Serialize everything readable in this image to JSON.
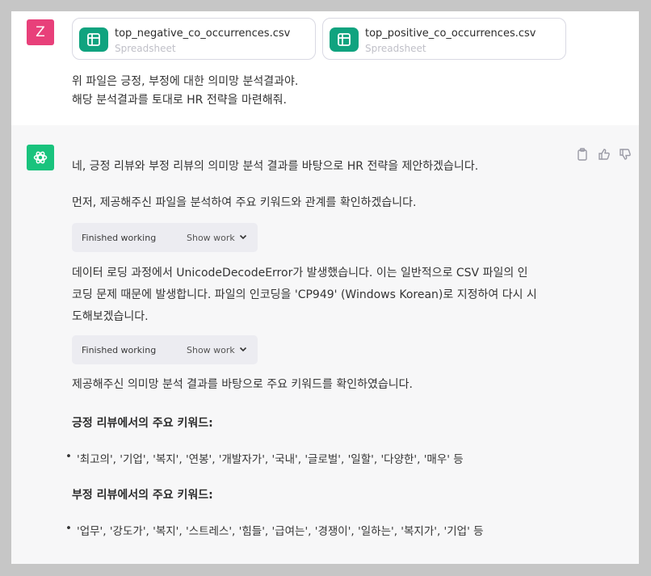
{
  "user": {
    "avatar_initial": "Z",
    "files": [
      {
        "name": "top_negative_co_occurrences.csv",
        "type": "Spreadsheet",
        "icon": "spreadsheet-icon"
      },
      {
        "name": "top_positive_co_occurrences.csv",
        "type": "Spreadsheet",
        "icon": "spreadsheet-icon"
      }
    ],
    "message_lines": [
      "위 파일은 긍정, 부정에 대한 의미망 분석결과야.",
      "해당 분석결과를 토대로 HR 전략을 마련해줘."
    ]
  },
  "assistant": {
    "intro": "네, 긍정 리뷰와 부정 리뷰의 의미망 분석 결과를 바탕으로 HR 전략을 제안하겠습니다.",
    "step1": "먼저, 제공해주신 파일을 분석하여 주요 키워드와 관계를 확인하겠습니다.",
    "work_boxes": [
      {
        "status": "Finished working",
        "toggle": "Show work"
      },
      {
        "status": "Finished working",
        "toggle": "Show work"
      }
    ],
    "error_lines": [
      "데이터 로딩 과정에서 UnicodeDecodeError가 발생했습니다. 이는 일반적으로 CSV 파일의 인",
      "코딩 문제 때문에 발생합니다. 파일의 인코딩을 'CP949' (Windows Korean)로 지정하여 다시 시",
      "도해보겠습니다."
    ],
    "result_intro": "제공해주신 의미망 분석 결과를 바탕으로 주요 키워드를 확인하였습니다.",
    "positive_heading": "긍정 리뷰에서의 주요 키워드:",
    "positive_keywords": "'최고의', '기업', '복지', '연봉', '개발자가', '국내', '글로벌', '일할', '다양한', '매우' 등",
    "negative_heading": "부정 리뷰에서의 주요 키워드:",
    "negative_keywords": "'업무', '강도가', '복지', '스트레스', '힘들', '급여는', '경쟁이', '일하는', '복지가', '기업' 등",
    "bullet": "•"
  },
  "colors": {
    "user_avatar": "#e8407a",
    "ai_avatar": "#19c37d",
    "file_icon": "#10a37f"
  }
}
